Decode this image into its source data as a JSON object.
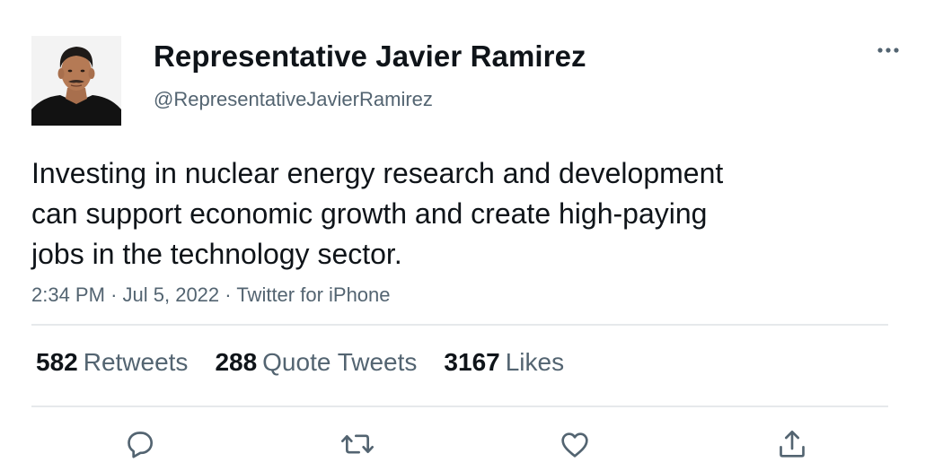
{
  "tweet": {
    "display_name": "Representative Javier Ramirez",
    "handle": "@RepresentativeJavierRamirez",
    "text_lines": [
      "Investing in nuclear energy research and development",
      "can support economic growth and create high-paying",
      "jobs in the technology sector."
    ],
    "time": "2:34 PM",
    "separator": "·",
    "date": "Jul 5, 2022",
    "source": "Twitter for iPhone"
  },
  "stats": {
    "retweets_count": "582",
    "retweets_label": "Retweets",
    "quotes_count": "288",
    "quotes_label": "Quote Tweets",
    "likes_count": "3167",
    "likes_label": "Likes"
  },
  "icons": {
    "more": "more-options-icon",
    "reply": "reply-icon",
    "retweet": "retweet-icon",
    "like": "heart-icon",
    "share": "share-icon"
  },
  "colors": {
    "text": "#0f1419",
    "secondary": "#536471",
    "divider": "#e6e9eb",
    "icon": "#536471"
  }
}
